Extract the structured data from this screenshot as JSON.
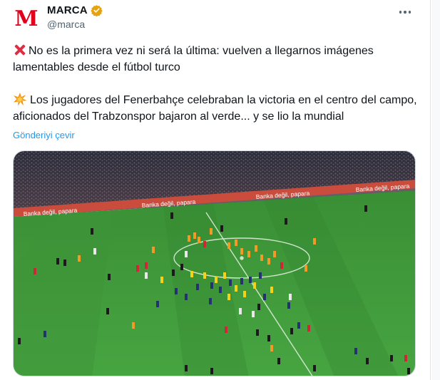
{
  "tweet": {
    "display_name": "MARCA",
    "handle": "@marca",
    "avatar_letter": "M",
    "verified_icon": "verified-badge-icon",
    "more_icon": "more-horizontal-icon",
    "paragraph1": "No es la primera vez ni será la última: vuelven a llegarnos imágenes lamentables desde el fútbol turco",
    "paragraph1_emoji": "cross-mark-icon",
    "paragraph2": "Los jugadores del Fenerbahçe celebraban la victoria en el centro del campo, aficionados del Trabzonspor bajaron al verde... y se lio la mundial",
    "paragraph2_emoji": "collision-icon",
    "translate_label": "Gönderiyi çevir"
  },
  "media": {
    "ad_boards": [
      "Banka değil, papara",
      "Banka değil, papara",
      "Banka değil, papara",
      "Banka değil, papara"
    ]
  },
  "colors": {
    "brand": "#e2001a",
    "verified": "#e8a20b",
    "link": "#1d9bf0",
    "pitch": "#3f9a3a",
    "pitch_dark": "#348632"
  }
}
